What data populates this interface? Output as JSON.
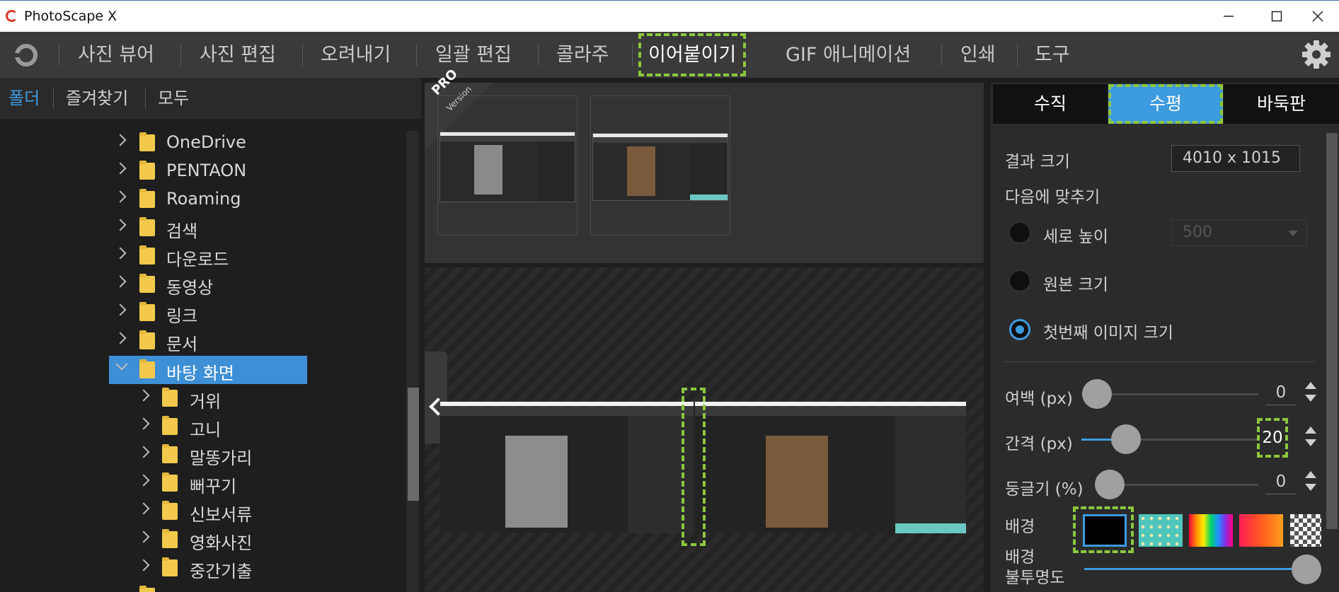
{
  "window": {
    "title": "PhotoScape X",
    "controls": [
      "minimize",
      "maximize",
      "close"
    ]
  },
  "menu": {
    "items": [
      {
        "label": "사진 뷰어"
      },
      {
        "label": "사진 편집"
      },
      {
        "label": "오려내기"
      },
      {
        "label": "일괄 편집"
      },
      {
        "label": "콜라주"
      },
      {
        "label": "이어붙이기",
        "active": true
      },
      {
        "label": "GIF 애니메이션"
      },
      {
        "label": "인쇄"
      },
      {
        "label": "도구"
      }
    ]
  },
  "subnav": {
    "items": [
      {
        "label": "폴더",
        "active": true
      },
      {
        "label": "즐겨찾기"
      },
      {
        "label": "모두"
      }
    ]
  },
  "tree": {
    "items": [
      {
        "label": "OneDrive",
        "icon": "onedrive-folder-icon"
      },
      {
        "label": "PENTAON",
        "icon": "folder-icon"
      },
      {
        "label": "Roaming",
        "icon": "folder-icon"
      },
      {
        "label": "검색",
        "icon": "search-folder-icon"
      },
      {
        "label": "다운로드",
        "icon": "download-folder-icon"
      },
      {
        "label": "동영상",
        "icon": "video-folder-icon"
      },
      {
        "label": "링크",
        "icon": "link-folder-icon"
      },
      {
        "label": "문서",
        "icon": "document-folder-icon"
      },
      {
        "label": "바탕 화면",
        "icon": "desktop-folder-icon",
        "selected": true,
        "expanded": true
      },
      {
        "label": "거위",
        "icon": "folder-icon"
      },
      {
        "label": "고니",
        "icon": "folder-icon"
      },
      {
        "label": "말똥가리",
        "icon": "folder-icon"
      },
      {
        "label": "뻐꾸기",
        "icon": "folder-icon"
      },
      {
        "label": "신보서류",
        "icon": "folder-icon"
      },
      {
        "label": "영화사진",
        "icon": "folder-icon"
      },
      {
        "label": "중간기출",
        "icon": "folder-icon"
      }
    ]
  },
  "badge": {
    "pro": "PRO",
    "version": "Version"
  },
  "panel": {
    "tabs": [
      {
        "label": "수직"
      },
      {
        "label": "수평",
        "active": true
      },
      {
        "label": "바둑판"
      }
    ],
    "result_size_label": "결과 크기",
    "result_size_value": "4010 x 1015",
    "fit_label": "다음에 맞추기",
    "fit_options": [
      {
        "label": "세로 높이",
        "selected": false
      },
      {
        "label": "원본 크기",
        "selected": false
      },
      {
        "label": "첫번째 이미지 크기",
        "selected": true
      }
    ],
    "height_dropdown_value": "500",
    "margin_label": "여백 (px)",
    "margin_value": "0",
    "spacing_label": "간격 (px)",
    "spacing_value": "20",
    "roundness_label": "둥글기 (%)",
    "roundness_value": "0",
    "background_label": "배경",
    "opacity_label_line1": "배경",
    "opacity_label_line2": "불투명도"
  },
  "colors": {
    "accent": "#3d9be0",
    "highlight": "#8cc63f",
    "selection": "#3d8fd6"
  }
}
